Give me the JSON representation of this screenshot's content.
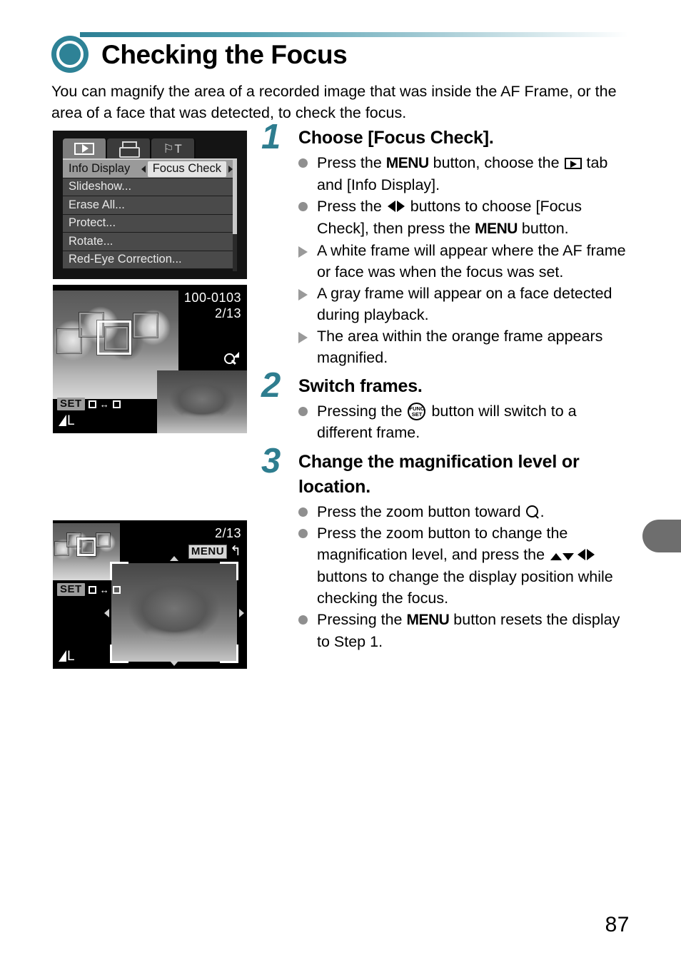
{
  "page": {
    "number": "87",
    "title": "Checking the Focus",
    "title_icon": "circle-ring-icon",
    "accent_color": "#2e8296",
    "intro": "You can magnify the area of a recorded image that was inside the AF Frame, or the area of a face that was detected, to check the focus."
  },
  "camera_menu": {
    "tabs": [
      {
        "name": "playback-tab",
        "icon": "play-tab-icon",
        "active": true
      },
      {
        "name": "print-tab",
        "icon": "printer-icon",
        "active": false
      },
      {
        "name": "settings-tab",
        "icon": "wrench-tools-icon",
        "active": false
      }
    ],
    "rows": [
      {
        "label": "Info Display",
        "value": "Focus Check",
        "selected": true
      },
      {
        "label": "Slideshow...",
        "value": "",
        "selected": false
      },
      {
        "label": "Erase All...",
        "value": "",
        "selected": false
      },
      {
        "label": "Protect...",
        "value": "",
        "selected": false
      },
      {
        "label": "Rotate...",
        "value": "",
        "selected": false
      },
      {
        "label": "Red-Eye Correction...",
        "value": "",
        "selected": false
      }
    ]
  },
  "screen_faces": {
    "file_number": "100-0103",
    "frame_counter": "2/13",
    "magnify_icon": "magnifier-icon",
    "set_label": "SET",
    "set_hint_icon": "frame-swap-icon",
    "quality_label": "L",
    "quality_icon": "image-quality-fine-icon"
  },
  "screen_zoom": {
    "frame_counter": "2/13",
    "menu_label": "MENU",
    "menu_return_icon": "return-arrow-icon",
    "set_label": "SET",
    "set_hint_icon": "frame-swap-icon",
    "quality_label": "L",
    "quality_icon": "image-quality-fine-icon"
  },
  "steps": [
    {
      "number": "1",
      "heading": "Choose [Focus Check].",
      "bullets": [
        {
          "marker": "dot",
          "segments": [
            {
              "type": "text",
              "value": "Press the "
            },
            {
              "type": "glyph",
              "value": "MENU",
              "icon": "menu-button-icon"
            },
            {
              "type": "text",
              "value": " button, choose the "
            },
            {
              "type": "glyph",
              "value": "",
              "icon": "playback-tab-icon"
            },
            {
              "type": "text",
              "value": " tab and [Info Display]."
            }
          ]
        },
        {
          "marker": "dot",
          "segments": [
            {
              "type": "text",
              "value": "Press the "
            },
            {
              "type": "glyph",
              "value": "",
              "icon": "left-right-arrows-icon"
            },
            {
              "type": "text",
              "value": " buttons to choose [Focus Check], then press the "
            },
            {
              "type": "glyph",
              "value": "MENU",
              "icon": "menu-button-icon"
            },
            {
              "type": "text",
              "value": " button."
            }
          ]
        },
        {
          "marker": "triangle",
          "segments": [
            {
              "type": "text",
              "value": "A white frame will appear where the AF frame or face was when the focus was set."
            }
          ]
        },
        {
          "marker": "triangle",
          "segments": [
            {
              "type": "text",
              "value": "A gray frame will appear on a face detected during playback."
            }
          ]
        },
        {
          "marker": "triangle",
          "segments": [
            {
              "type": "text",
              "value": "The area within the orange frame appears magnified."
            }
          ]
        }
      ]
    },
    {
      "number": "2",
      "heading": "Switch frames.",
      "bullets": [
        {
          "marker": "dot",
          "segments": [
            {
              "type": "text",
              "value": "Pressing the "
            },
            {
              "type": "glyph",
              "value": "FUNC. SET",
              "icon": "func-set-button-icon"
            },
            {
              "type": "text",
              "value": " button will switch to a different frame."
            }
          ]
        }
      ]
    },
    {
      "number": "3",
      "heading": "Change the magnification level or location.",
      "bullets": [
        {
          "marker": "dot",
          "segments": [
            {
              "type": "text",
              "value": "Press the zoom button toward "
            },
            {
              "type": "glyph",
              "value": "",
              "icon": "magnifier-icon"
            },
            {
              "type": "text",
              "value": "."
            }
          ]
        },
        {
          "marker": "dot",
          "segments": [
            {
              "type": "text",
              "value": "Press the zoom button to change the magnification level, and press the "
            },
            {
              "type": "glyph",
              "value": "",
              "icon": "up-down-left-right-arrows-icon"
            },
            {
              "type": "text",
              "value": " buttons to change the display position while checking the focus."
            }
          ]
        },
        {
          "marker": "dot",
          "segments": [
            {
              "type": "text",
              "value": "Pressing the "
            },
            {
              "type": "glyph",
              "value": "MENU",
              "icon": "menu-button-icon"
            },
            {
              "type": "text",
              "value": " button resets the display to Step 1."
            }
          ]
        }
      ]
    }
  ],
  "step_text": {
    "s1_heading": "Choose [Focus Check].",
    "s1_b1_a": "Press the ",
    "s1_b1_menu": "MENU",
    "s1_b1_b": " button, choose the ",
    "s1_b1_c": " tab and [Info Display].",
    "s1_b2_a": "Press the ",
    "s1_b2_b": " buttons to choose [Focus Check], then press the ",
    "s1_b2_menu": "MENU",
    "s1_b2_c": " button.",
    "s1_b3": "A white frame will appear where the AF frame or face was when the focus was set.",
    "s1_b4": "A gray frame will appear on a face detected during playback.",
    "s1_b5": "The area within the orange frame appears magnified.",
    "s2_heading": "Switch frames.",
    "s2_b1_a": "Pressing the ",
    "s2_b1_b": " button will switch to a different frame.",
    "s3_heading": "Change the magnification level or location.",
    "s3_b1_a": "Press the zoom button toward ",
    "s3_b1_b": ".",
    "s3_b2_a": "Press the zoom button to change the magnification level, and press the ",
    "s3_b2_b": " buttons to change the display position while checking the focus.",
    "s3_b3_a": "Pressing the ",
    "s3_b3_menu": "MENU",
    "s3_b3_b": " button resets the display to Step 1.",
    "num1": "1",
    "num2": "2",
    "num3": "3",
    "func_top": "FUNC.",
    "func_bottom": "SET"
  }
}
